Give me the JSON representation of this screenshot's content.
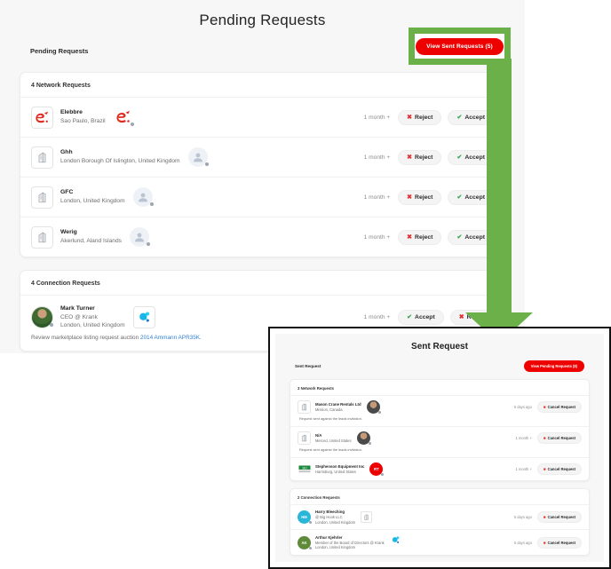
{
  "colors": {
    "red": "#ef0000",
    "green": "#6cb04a",
    "accept_green": "#33a852",
    "reject_red": "#e23030"
  },
  "main": {
    "page_title": "Pending Requests",
    "subbar_label": "Pending Requests",
    "view_sent_button": "View Sent Requests (5)",
    "network_section": {
      "header": "4 Network Requests",
      "rows": [
        {
          "name": "Elebbre",
          "location": "Sao Paulo, Brazil",
          "time": "1 month +",
          "reject": "Reject",
          "accept": "Accept"
        },
        {
          "name": "Ghh",
          "location": "London Borough Of Islington, United Kingdom",
          "time": "1 month +",
          "reject": "Reject",
          "accept": "Accept"
        },
        {
          "name": "GFC",
          "location": "London, United Kingdom",
          "time": "1 month +",
          "reject": "Reject",
          "accept": "Accept"
        },
        {
          "name": "Werig",
          "location": "Akerlund, Aland Islands",
          "time": "1 month +",
          "reject": "Reject",
          "accept": "Accept"
        }
      ]
    },
    "connection_section": {
      "header": "4 Connection Requests",
      "rows": [
        {
          "name": "Mark Turner",
          "title": "CEO @ Krank",
          "location": "London, United Kingdom",
          "time": "1 month +",
          "accept": "Accept",
          "reject": "Reject",
          "message_prefix": "Review marketplace listing request auction ",
          "message_link": "2014 Ammann APR35K."
        }
      ]
    }
  },
  "inset": {
    "page_title": "Sent Request",
    "subbar_label": "Sent Request",
    "view_pending_button": "View Pending Requests (8)",
    "network_section": {
      "header": "3 Network Requests",
      "rows": [
        {
          "name": "Mason Crane Rentals Ltd",
          "location": "Mission, Canada",
          "time": "5 days ago",
          "cancel": "Cancel Request",
          "note": "Request sent against the leads invitation.",
          "avatar_type": "photo-avatar"
        },
        {
          "name": "N/A",
          "location": "Merced, United States",
          "time": "1 month +",
          "cancel": "Cancel Request",
          "note": "Request sent against the leads invitation.",
          "avatar_type": "photo-avatar"
        },
        {
          "name": "Stephenson Equipment Inc",
          "location": "Harrisburg, United States",
          "time": "1 month +",
          "cancel": "Cancel Request",
          "note": "",
          "avatar_type": "red-badge",
          "badge_text": "RT"
        }
      ]
    },
    "connection_section": {
      "header": "2 Connection Requests",
      "rows": [
        {
          "name": "Harry Bleeching",
          "title": "@ Big Hook LLC",
          "location": "London, United Kingdom",
          "time": "5 days ago",
          "cancel": "Cancel Request",
          "initials": "HM",
          "initials_color": "#29b6d8"
        },
        {
          "name": "Arthur Kjehrler",
          "title": "Member of the Board of Directors @ Krank",
          "location": "London, United Kingdom",
          "time": "5 days ago",
          "cancel": "Cancel Request",
          "initials": "AK",
          "initials_color": "#5f8a3a"
        }
      ]
    }
  },
  "icons": {
    "reject": "✖",
    "accept": "✔",
    "cancel": "■"
  }
}
